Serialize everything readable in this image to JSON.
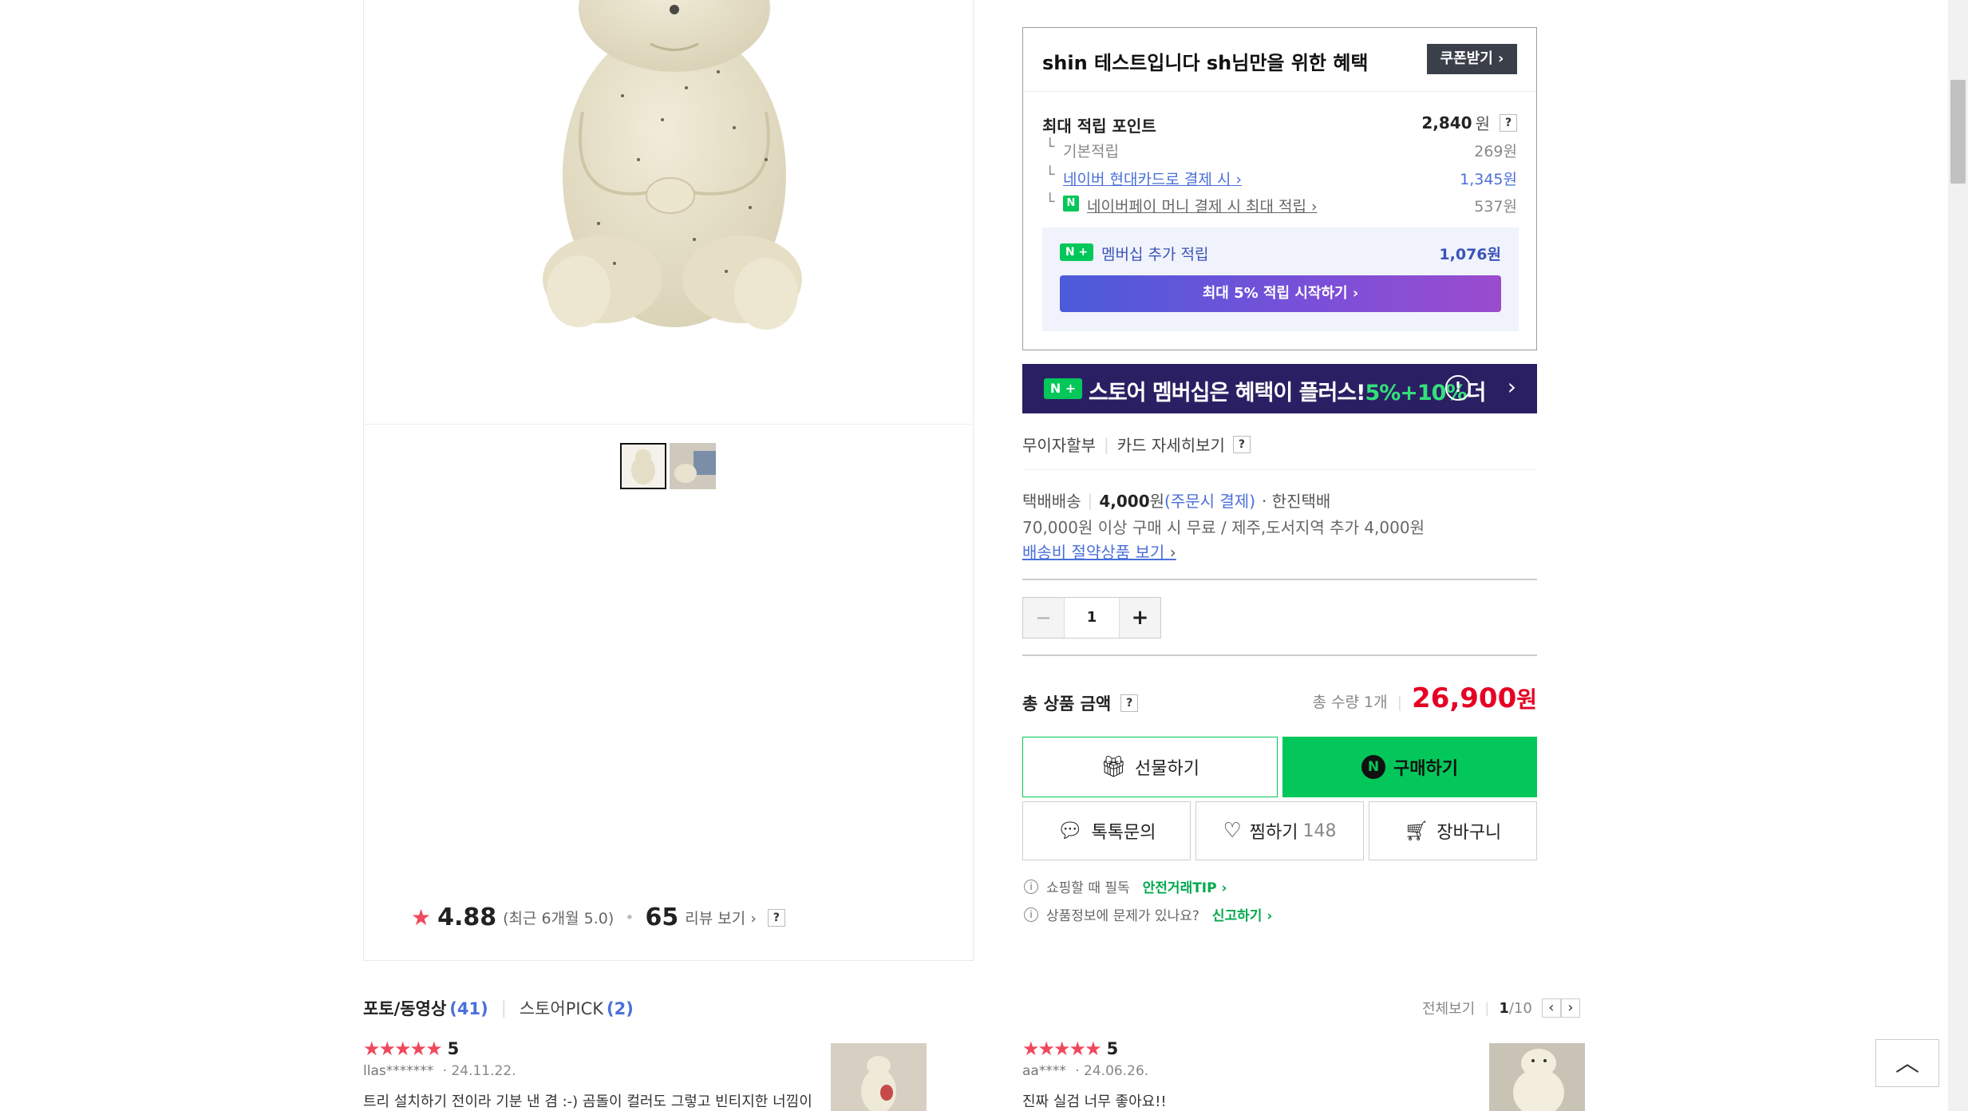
{
  "benefit": {
    "title": "shin 테스트입니다 sh님만을 위한 혜택",
    "coupon_button": "쿠폰받기",
    "max_points_label": "최대 적립 포인트",
    "max_points_value": "2,840",
    "won": "원",
    "rows": [
      {
        "label": "기본적립",
        "value": "269원"
      },
      {
        "label": "네이버 현대카드로 결제 시",
        "value": "1,345원"
      },
      {
        "label": "네이버페이 머니 결제 시 최대 적립",
        "value": "537원"
      }
    ],
    "membership_label": "멤버십 추가 적립",
    "membership_value": "1,076원",
    "membership_button": "최대 5% 적립 시작하기",
    "help_q": "?"
  },
  "banner": {
    "text": "스토어 멤버십은 혜택이 플러스!",
    "highlight": "5%+10%",
    "suffix": "더"
  },
  "installment": {
    "label": "무이자할부",
    "card_link": "카드 자세히보기"
  },
  "delivery": {
    "type": "택배배송",
    "fee": "4,000",
    "fee_unit": "원",
    "fee_note": "(주문시 결제)",
    "courier": "· 한진택배",
    "free_condition": "70,000원 이상 구매 시 무료 / 제주,도서지역 추가 4,000원",
    "saving_link": "배송비 절약상품 보기"
  },
  "quantity": {
    "value": "1",
    "minus": "−",
    "plus": "+"
  },
  "total": {
    "label": "총 상품 금액",
    "count_label": "총 수량 1개",
    "price": "26,900",
    "unit": "원"
  },
  "buttons": {
    "gift": "선물하기",
    "buy": "구매하기",
    "talk": "톡톡문의",
    "wish": "찜하기",
    "wish_count": "148",
    "cart": "장바구니"
  },
  "tips": [
    {
      "text": "쇼핑할 때 필독",
      "link": "안전거래TIP"
    },
    {
      "text": "상품정보에 문제가 있나요?",
      "link": "신고하기"
    }
  ],
  "rating": {
    "score": "4.88",
    "recent": "(최근 6개월 5.0)",
    "review_count": "65",
    "review_link": "리뷰 보기"
  },
  "review_tabs": [
    {
      "label": "포토/동영상",
      "count": "(41)"
    },
    {
      "label": "스토어PICK",
      "count": "(2)"
    }
  ],
  "review_nav": {
    "all": "전체보기",
    "page": "1",
    "total": "/10"
  },
  "reviews": [
    {
      "stars": "★★★★★",
      "score": "5",
      "user": "llas*******",
      "date": "· 24.11.22.",
      "text": "트리 설치하기 전이라 기분 낸 겸 :-) 곰돌이 컬러도 그렇고 빈티지한 너낌이"
    },
    {
      "stars": "★★★★★",
      "score": "5",
      "user": "aa****",
      "date": "· 24.06.26.",
      "text": "진짜 실검 너무 좋아요!!"
    }
  ],
  "colors": {
    "price_red": "#e60023",
    "npay_green": "#03c75a",
    "link_blue": "#4a6fd9",
    "star_red": "#f0485c"
  }
}
